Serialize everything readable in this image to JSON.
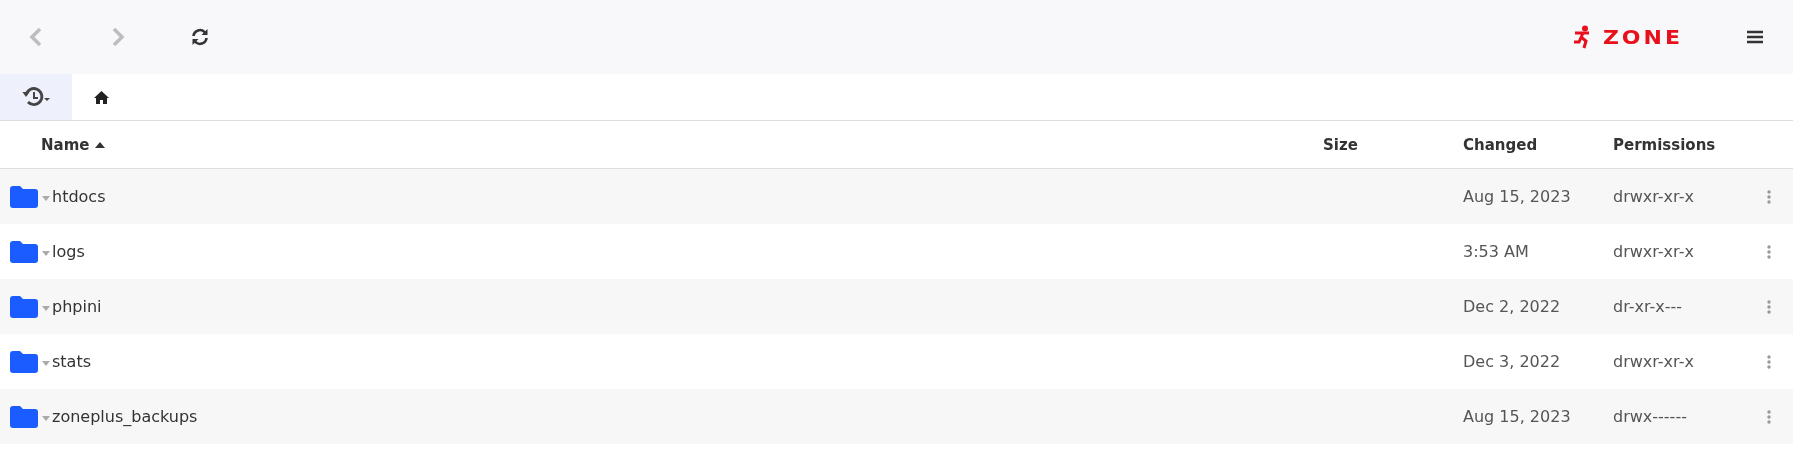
{
  "toolbar": {
    "buttons": [
      {
        "kind": "back",
        "disabled": true
      },
      {
        "kind": "forward",
        "disabled": true
      },
      {
        "kind": "refresh",
        "disabled": false
      }
    ],
    "logo": "ZONE"
  },
  "breadcrumb": {
    "history_button": {
      "selected": true
    }
  },
  "table": {
    "columns": [
      {
        "label": "Name",
        "sorted": true
      },
      {
        "label": "Size",
        "sorted": false
      },
      {
        "label": "Changed",
        "sorted": false
      },
      {
        "label": "Permissions",
        "sorted": false
      }
    ],
    "rows": [
      {
        "name": "htdocs",
        "changed": "Aug 15, 2023",
        "permissions": "drwxr-xr-x"
      },
      {
        "name": "logs",
        "changed": "3:53 AM",
        "permissions": "drwxr-xr-x"
      },
      {
        "name": "phpini",
        "changed": "Dec 2, 2022",
        "permissions": "dr-xr-x---"
      },
      {
        "name": "stats",
        "changed": "Dec 3, 2022",
        "permissions": "drwxr-xr-x"
      },
      {
        "name": "zoneplus_backups",
        "changed": "Aug 15, 2023",
        "permissions": "drwx------"
      }
    ]
  }
}
